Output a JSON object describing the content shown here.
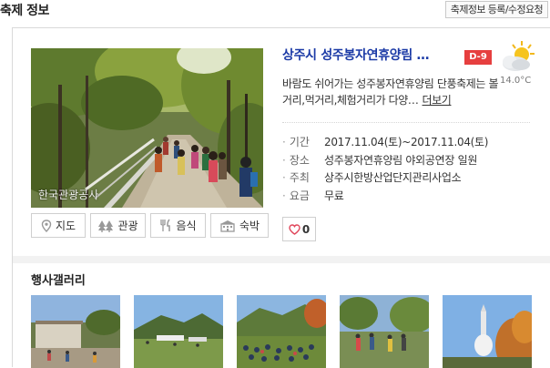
{
  "header": {
    "title": "축제 정보",
    "request_button": "축제정보 등록/수정요청"
  },
  "event": {
    "title": "상주시 성주봉자연휴양림 …",
    "dday": "D-9",
    "temperature": "14.0°C",
    "description": "바람도 쉬어가는 성주봉자연휴양림 단풍축제는 볼거리,먹거리,체험거리가 다양…",
    "more_link": "더보기",
    "photo_credit": "한국관광공사",
    "like_count": "0"
  },
  "info": [
    {
      "label": "기간",
      "value": "2017.11.04(토)~2017.11.04(토)"
    },
    {
      "label": "장소",
      "value": "성주봉자연휴양림 야외공연장 일원"
    },
    {
      "label": "주최",
      "value": "상주시한방산업단지관리사업소"
    },
    {
      "label": "요금",
      "value": "무료"
    }
  ],
  "buttons": {
    "map": "지도",
    "tour": "관광",
    "food": "음식",
    "stay": "숙박"
  },
  "gallery": {
    "title": "행사갤러리"
  },
  "colors": {
    "title_blue": "#1b3aa6",
    "dday_red": "#e63f3f",
    "heart_red": "#e0455a"
  }
}
